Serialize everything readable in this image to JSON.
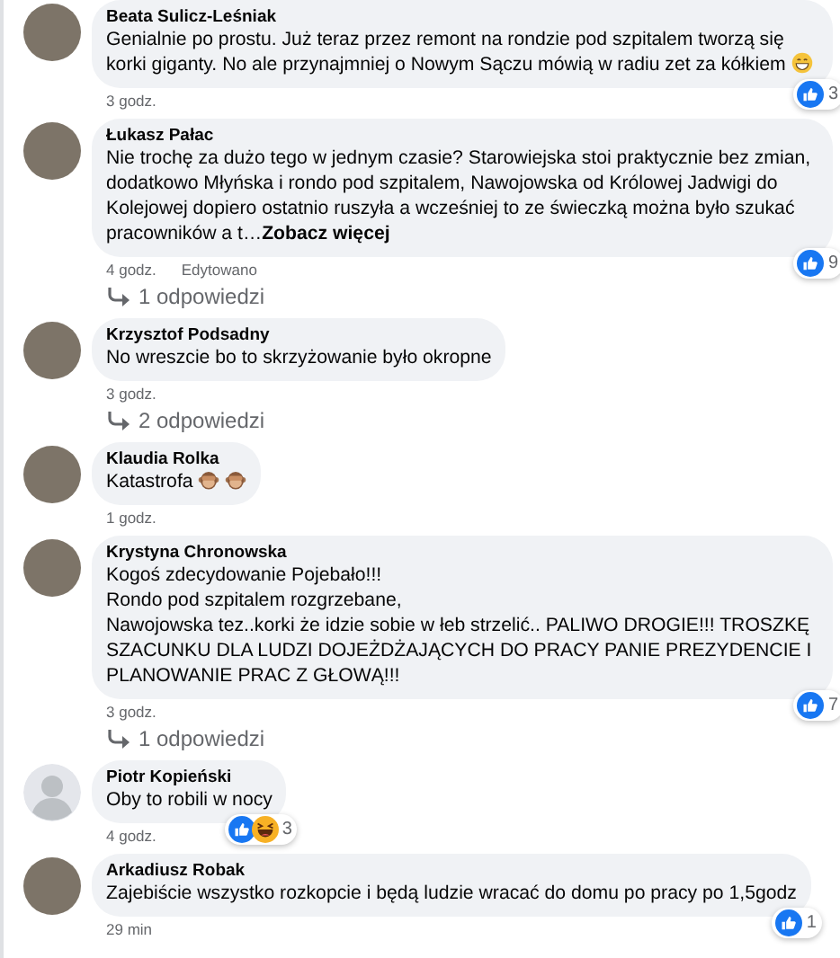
{
  "comments": [
    {
      "author": "Beata Sulicz-Leśniak",
      "avatar": {
        "kind": "photo"
      },
      "text": "Genialnie po prostu. Już teraz przez remont na rondzie pod szpitalem tworzą się korki giganty. No ale przynajmniej o Nowym Sączu mówią w radiu zet za kółkiem",
      "emojis": [
        {
          "kind": "grin"
        }
      ],
      "reactions": [
        {
          "kind": "like"
        }
      ],
      "reaction_count": "3",
      "time": "3 godz."
    },
    {
      "author": "Łukasz Pałac",
      "avatar": {
        "kind": "photo"
      },
      "text": "Nie trochę za dużo tego w jednym czasie? Starowiejska stoi praktycznie bez zmian, dodatkowo Młyńska i rondo pod szpitalem, Nawojowska od Królowej Jadwigi do Kolejowej dopiero ostatnio ruszyła a wcześniej to ze świeczką można było szukać pracowników a t…",
      "see_more": "Zobacz więcej",
      "reactions": [
        {
          "kind": "like"
        }
      ],
      "reaction_count": "9",
      "time": "4 godz.",
      "edited": "Edytowano",
      "replies": "1 odpowiedzi"
    },
    {
      "author": "Krzysztof Podsadny",
      "avatar": {
        "kind": "photo"
      },
      "text": "No wreszcie bo to skrzyżowanie było okropne",
      "time": "3 godz.",
      "replies": "2 odpowiedzi"
    },
    {
      "author": "Klaudia Rolka",
      "avatar": {
        "kind": "photo"
      },
      "text": "Katastrofa",
      "emojis": [
        {
          "kind": "monkey"
        },
        {
          "kind": "monkey"
        }
      ],
      "time": "1 godz."
    },
    {
      "author": "Krystyna Chronowska",
      "avatar": {
        "kind": "photo"
      },
      "text": "Kogoś zdecydowanie Pojebało!!!\nRondo pod szpitalem rozgrzebane,\nNawojowska tez..korki że idzie sobie w łeb strzelić.. PALIWO DROGIE!!! TROSZKĘ SZACUNKU DLA LUDZI DOJEŻDŻAJĄCYCH DO PRACY PANIE PREZYDENCIE I PLANOWANIE PRAC Z GŁOWĄ!!!",
      "reactions": [
        {
          "kind": "like"
        }
      ],
      "reaction_count": "7",
      "time": "3 godz.",
      "replies": "1 odpowiedzi"
    },
    {
      "author": "Piotr Kopieński",
      "avatar": {
        "kind": "silhouette"
      },
      "text": "Oby to robili w nocy",
      "reactions": [
        {
          "kind": "like"
        },
        {
          "kind": "haha"
        }
      ],
      "reaction_count": "3",
      "time": "4 godz."
    },
    {
      "author": "Arkadiusz Robak",
      "avatar": {
        "kind": "photo"
      },
      "text": "Zajebiście wszystko rozkopcie i będą ludzie wracać do domu po pracy po 1,5godz",
      "reactions": [
        {
          "kind": "like"
        }
      ],
      "reaction_count": "1",
      "time": "29 min"
    }
  ]
}
